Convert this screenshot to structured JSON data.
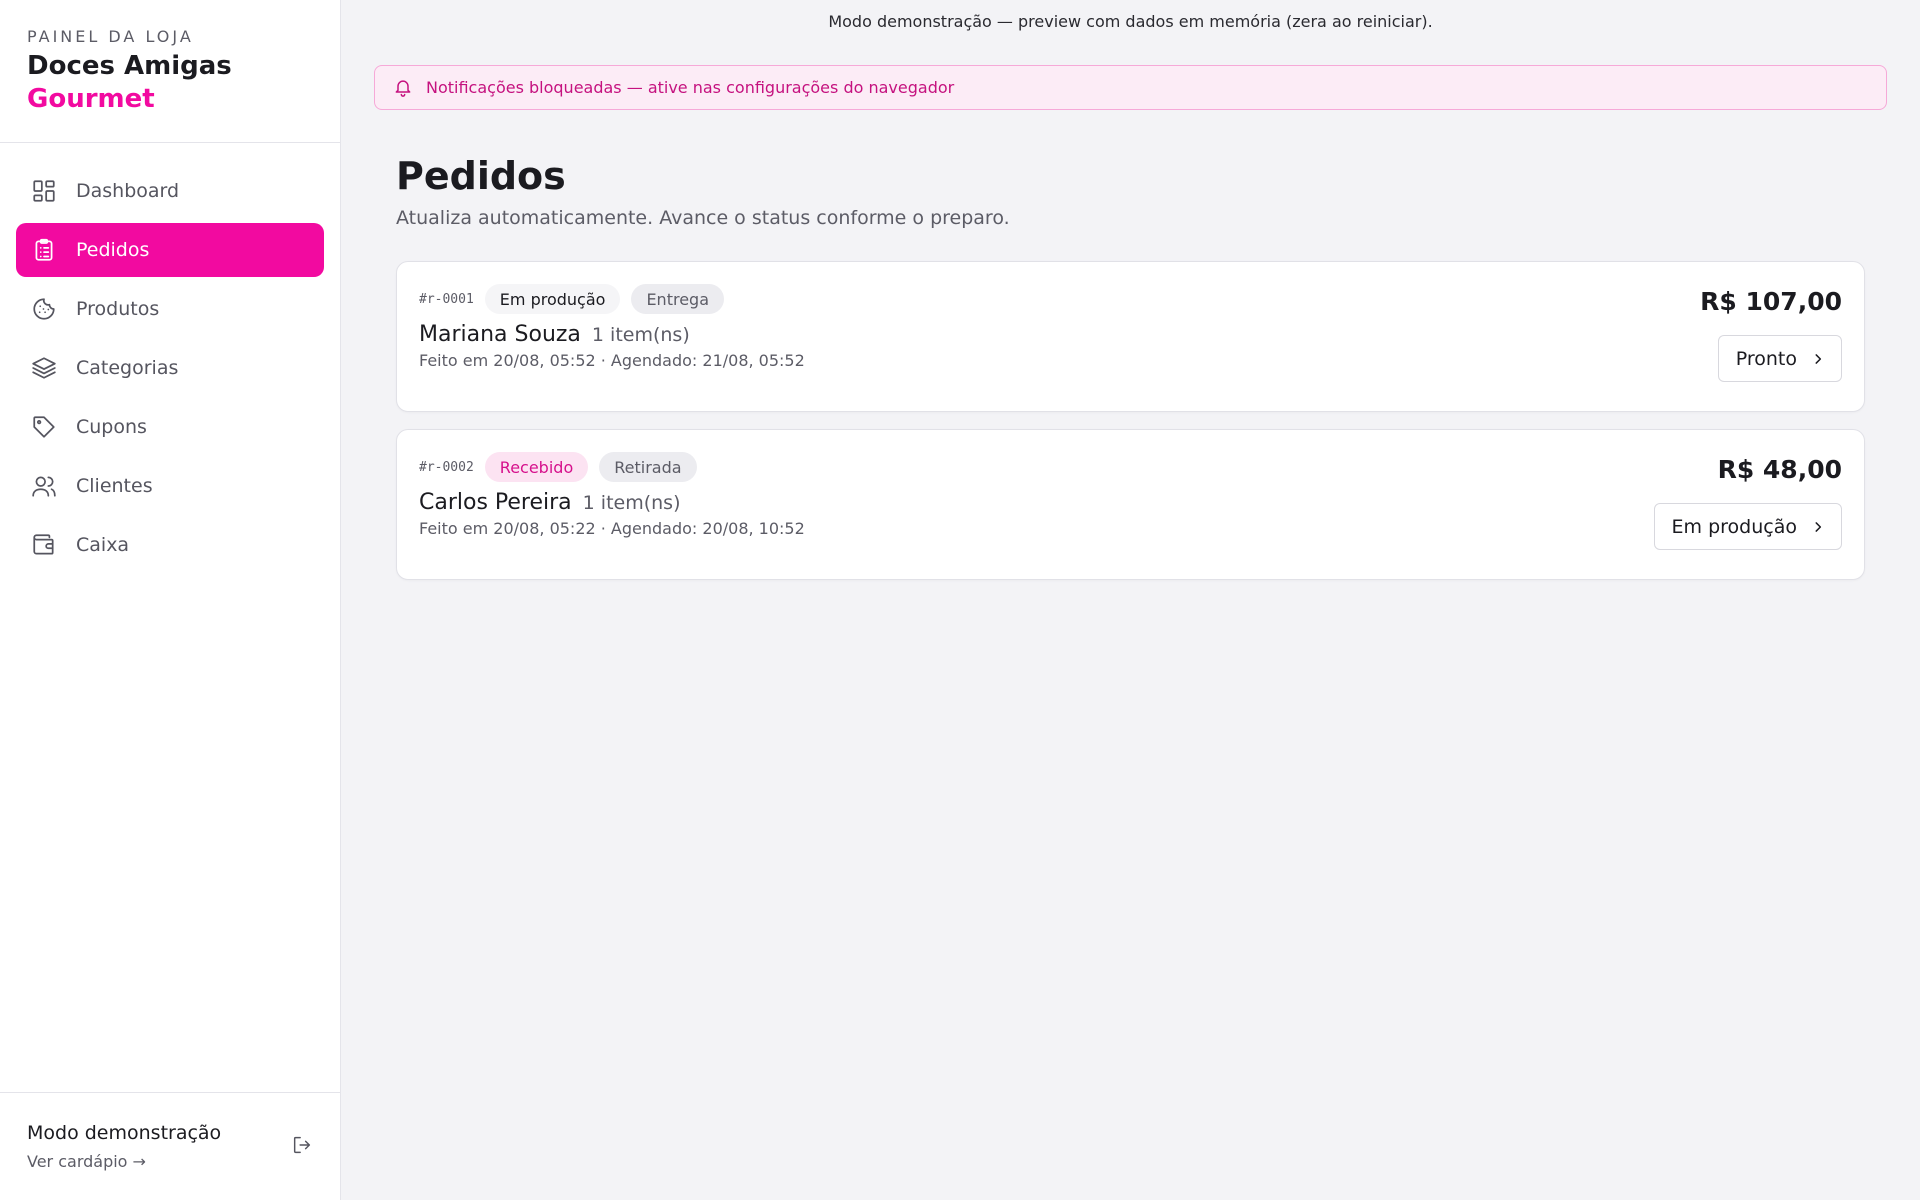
{
  "brand": {
    "eyebrow": "PAINEL DA LOJA",
    "name": "Doces Amigas",
    "sub": "Gourmet",
    "accent_color": "#f20aa0"
  },
  "sidebar": {
    "items": [
      {
        "label": "Dashboard",
        "icon": "dashboard-icon",
        "active": false
      },
      {
        "label": "Pedidos",
        "icon": "clipboard-icon",
        "active": true
      },
      {
        "label": "Produtos",
        "icon": "cookie-icon",
        "active": false
      },
      {
        "label": "Categorias",
        "icon": "layers-icon",
        "active": false
      },
      {
        "label": "Cupons",
        "icon": "tag-icon",
        "active": false
      },
      {
        "label": "Clientes",
        "icon": "users-icon",
        "active": false
      },
      {
        "label": "Caixa",
        "icon": "wallet-icon",
        "active": false
      }
    ],
    "footer": {
      "title": "Modo demonstração",
      "link": "Ver cardápio →",
      "logout_icon": "logout-icon"
    }
  },
  "banner": {
    "text": "Modo demonstração — preview com dados em memória (zera ao reiniciar)."
  },
  "notification": {
    "icon": "bell-icon",
    "text": "Notificações bloqueadas — ative nas configurações do navegador"
  },
  "page": {
    "title": "Pedidos",
    "subtitle": "Atualiza automaticamente. Avance o status conforme o preparo."
  },
  "orders": [
    {
      "id": "#r-0001",
      "status": "Em produção",
      "type": "Entrega",
      "customer": "Mariana Souza",
      "items": "1 item(ns)",
      "meta": "Feito em 20/08, 05:52 · Agendado: 21/08, 05:52",
      "total": "R$ 107,00",
      "action": "Pronto"
    },
    {
      "id": "#r-0002",
      "status": "Recebido",
      "type": "Retirada",
      "customer": "Carlos Pereira",
      "items": "1 item(ns)",
      "meta": "Feito em 20/08, 05:22 · Agendado: 20/08, 10:52",
      "total": "R$ 48,00",
      "action": "Em produção"
    }
  ]
}
